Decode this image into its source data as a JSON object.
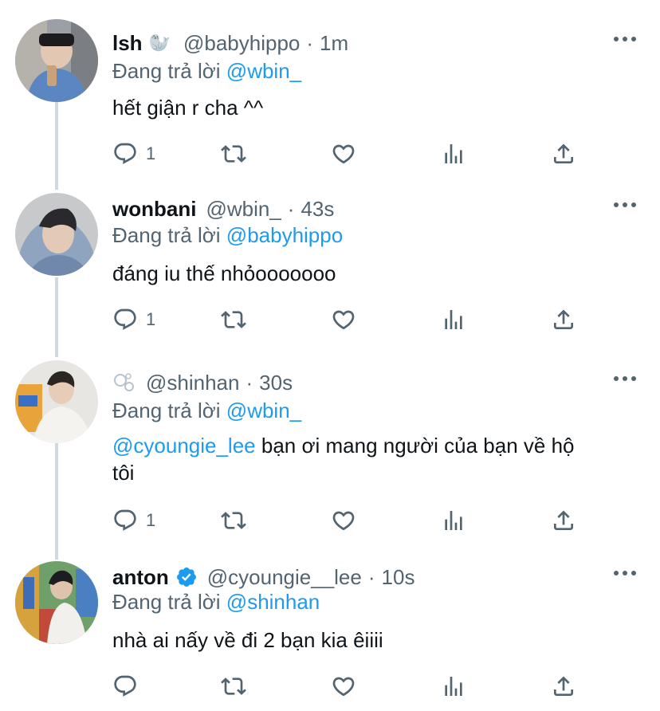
{
  "tweets": [
    {
      "name": "lsh",
      "name_emoji": "🦭",
      "handle": "@babyhippo",
      "separator": "·",
      "time": "1m",
      "replying_prefix": "Đang trả lời",
      "replying_to": "@wbin_",
      "text": "hết giận r cha ^^",
      "reply_count": "1",
      "verified": false
    },
    {
      "name": "wonbani",
      "handle": "@wbin_",
      "separator": "·",
      "time": "43s",
      "replying_prefix": "Đang trả lời",
      "replying_to": "@babyhippo",
      "text": "đáng iu thế nhỏooooooo",
      "reply_count": "1",
      "verified": false
    },
    {
      "name_icon": "bubbles-icon",
      "handle": "@shinhan",
      "separator": "·",
      "time": "30s",
      "replying_prefix": "Đang trả lời",
      "replying_to": "@wbin_",
      "mention": "@cyoungie_lee",
      "text_line1": " bạn ơi mang người của bạn về hộ",
      "text_line2": "tôi",
      "reply_count": "1",
      "verified": false
    },
    {
      "name": "anton",
      "handle": "@cyoungie__lee",
      "separator": "·",
      "time": "10s",
      "replying_prefix": "Đang trả lời",
      "replying_to": "@shinhan",
      "text": "nhà ai nấy về đi 2 bạn kia êiiii",
      "reply_count": "",
      "verified": true
    }
  ],
  "colors": {
    "link": "#1d9bf0",
    "secondary_text": "#536471",
    "primary_text": "#0f1419",
    "thread_line": "#cfd9de"
  },
  "icons": [
    "reply-icon",
    "retweet-icon",
    "like-icon",
    "analytics-icon",
    "share-icon",
    "more-icon",
    "verified-icon"
  ]
}
